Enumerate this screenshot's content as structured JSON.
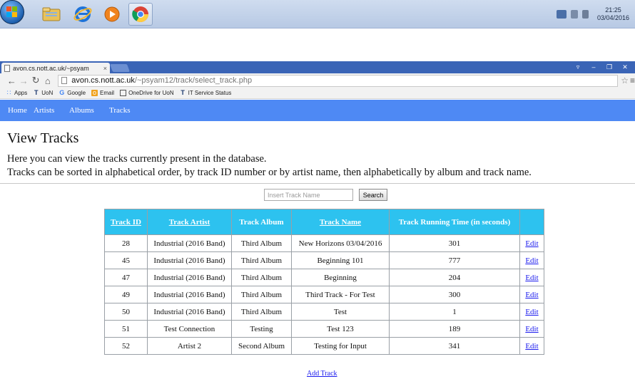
{
  "taskbar": {
    "clock_time": "21:25",
    "clock_date": "03/04/2016"
  },
  "browser": {
    "tab_title": "avon.cs.nott.ac.uk/~psyam",
    "tab_close": "×",
    "url_host": "avon.cs.nott.ac.uk",
    "url_path": "/~psyam12/track/select_track.php",
    "bookmarks": [
      "Apps",
      "UoN",
      "Google",
      "Email",
      "OneDrive for UoN",
      "IT Service Status"
    ]
  },
  "page": {
    "nav": [
      "Home",
      "Artists",
      "Albums",
      "Tracks"
    ],
    "title": "View Tracks",
    "intro_line1": "Here you can view the tracks currently present in the database.",
    "intro_line2": "Tracks can be sorted in alphabetical order, by track ID number or by artist name, then alphabetically by album and track name.",
    "search_placeholder": "Insert Track Name",
    "search_button": "Search",
    "table": {
      "headers": [
        "Track ID",
        "Track Artist",
        "Track Album",
        "Track Name",
        "Track Running Time (in seconds)",
        ""
      ],
      "rows": [
        [
          "28",
          "Industrial (2016 Band)",
          "Third Album",
          "New Horizons 03/04/2016",
          "301",
          "Edit"
        ],
        [
          "45",
          "Industrial (2016 Band)",
          "Third Album",
          "Beginning 101",
          "777",
          "Edit"
        ],
        [
          "47",
          "Industrial (2016 Band)",
          "Third Album",
          "Beginning",
          "204",
          "Edit"
        ],
        [
          "49",
          "Industrial (2016 Band)",
          "Third Album",
          "Third Track - For Test",
          "300",
          "Edit"
        ],
        [
          "50",
          "Industrial (2016 Band)",
          "Third Album",
          "Test",
          "1",
          "Edit"
        ],
        [
          "51",
          "Test Connection",
          "Testing",
          "Test 123",
          "189",
          "Edit"
        ],
        [
          "52",
          "Artist 2",
          "Second Album",
          "Testing for Input",
          "341",
          "Edit"
        ]
      ]
    },
    "add_track": "Add Track"
  },
  "colors": {
    "navbar": "#4e89f4",
    "table_header": "#2dc2ef",
    "link": "#1a1aee"
  }
}
